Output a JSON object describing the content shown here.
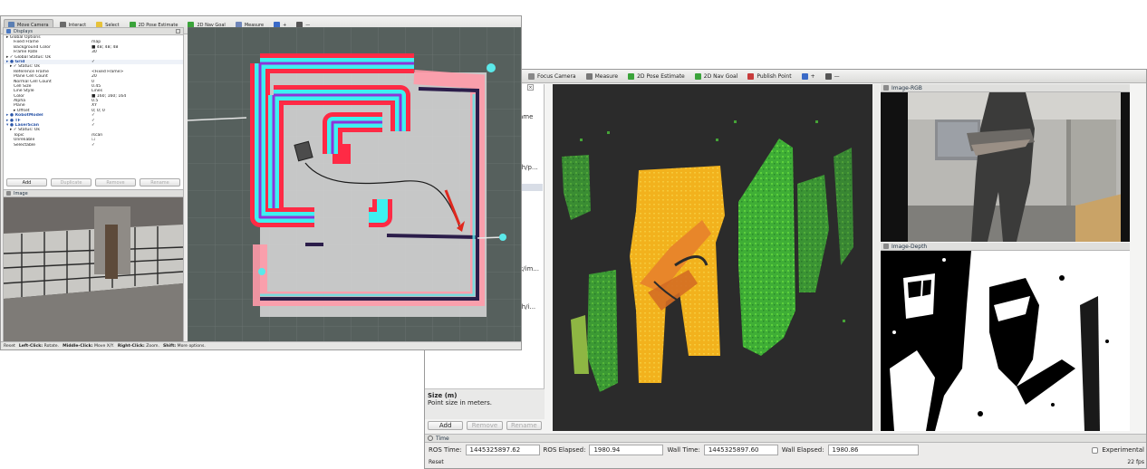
{
  "left_window": {
    "toolbar": [
      {
        "label": "Move Camera",
        "icon": "move-camera-icon",
        "color": "#5b7fb3",
        "active": true
      },
      {
        "label": "Interact",
        "icon": "interact-icon",
        "color": "#6a6a6a"
      },
      {
        "label": "Select",
        "icon": "select-icon",
        "color": "#e7c23a"
      },
      {
        "label": "2D Pose Estimate",
        "icon": "pose-arrow-icon",
        "color": "#3aa33a"
      },
      {
        "label": "2D Nav Goal",
        "icon": "nav-goal-icon",
        "color": "#3aa33a"
      },
      {
        "label": "Measure",
        "icon": "measure-icon",
        "color": "#6f86b9"
      },
      {
        "label": "+",
        "icon": "add-tool-icon",
        "color": "#3a6ac7"
      },
      {
        "label": "—",
        "icon": "remove-tool-icon",
        "color": "#555"
      }
    ],
    "displays_title": "Displays",
    "displays_rows": [
      {
        "k": "▸ Global Options",
        "v": "",
        "bold": false,
        "indent": 0
      },
      {
        "k": "Fixed Frame",
        "v": "map",
        "indent": 2
      },
      {
        "k": "Background Color",
        "v": "■ 48; 48; 48",
        "indent": 2
      },
      {
        "k": "Frame Rate",
        "v": "30",
        "indent": 2
      },
      {
        "k": "▸ ✓ Global Status: Ok",
        "v": "",
        "indent": 0
      },
      {
        "k": "▸ ● Grid",
        "v": "✓",
        "bold": true,
        "indent": 0
      },
      {
        "k": "▸ ✓ Status: Ok",
        "v": "",
        "indent": 1
      },
      {
        "k": "Reference Frame",
        "v": "<Fixed Frame>",
        "indent": 2
      },
      {
        "k": "Plane Cell Count",
        "v": "20",
        "indent": 2
      },
      {
        "k": "Normal Cell Count",
        "v": "0",
        "indent": 2
      },
      {
        "k": "Cell Size",
        "v": "0.45",
        "indent": 2
      },
      {
        "k": "Line Style",
        "v": "Lines",
        "indent": 2
      },
      {
        "k": "Color",
        "v": "■ 160; 160; 164",
        "indent": 2
      },
      {
        "k": "Alpha",
        "v": "0.5",
        "indent": 2
      },
      {
        "k": "Plane",
        "v": "XY",
        "indent": 2
      },
      {
        "k": "▸ Offset",
        "v": "0; 0; 0",
        "indent": 2
      },
      {
        "k": "▸ ● RobotModel",
        "v": "✓",
        "bold": true,
        "indent": 0
      },
      {
        "k": "▸ ● TF",
        "v": "✓",
        "bold": true,
        "indent": 0
      },
      {
        "k": "▾ ● LaserScan",
        "v": "✓",
        "bold": true,
        "indent": 0
      },
      {
        "k": "▸ ✓ Status: Ok",
        "v": "",
        "indent": 1
      },
      {
        "k": "Topic",
        "v": "/scan",
        "indent": 2
      },
      {
        "k": "Unreliable",
        "v": "☐",
        "indent": 2
      },
      {
        "k": "Selectable",
        "v": "✓",
        "indent": 2
      }
    ],
    "buttons": [
      "Add",
      "Duplicate",
      "Remove",
      "Rename"
    ],
    "image_title": "Image",
    "status": {
      "reset": "Reset",
      "t1": "Left-Click:",
      "d1": "Rotate.",
      "t2": "Middle-Click:",
      "d2": "Move X/Y.",
      "t3": "Right-Click:",
      "d3": "Zoom.",
      "t4": "Shift:",
      "d4": "More options."
    }
  },
  "right_window": {
    "toolbar": [
      {
        "label": "Focus Camera",
        "icon": "focus-camera-icon",
        "color": "#888"
      },
      {
        "label": "Measure",
        "icon": "measure-icon",
        "color": "#777"
      },
      {
        "label": "2D Pose Estimate",
        "icon": "pose-arrow-icon",
        "color": "#3aa33a"
      },
      {
        "label": "2D Nav Goal",
        "icon": "nav-goal-icon",
        "color": "#3aa33a"
      },
      {
        "label": "Publish Point",
        "icon": "publish-point-icon",
        "color": "#c83c3c"
      },
      {
        "label": "+",
        "icon": "add-tool-icon",
        "color": "#3a6ac7"
      },
      {
        "label": "—",
        "icon": "remove-tool-icon",
        "color": "#555"
      }
    ],
    "side_fragments": [
      "ame",
      "th/p...",
      "x/im...",
      "th/i..."
    ],
    "size_title": "Size (m)",
    "size_desc": "Point size in meters.",
    "buttons": [
      "Add",
      "Remove",
      "Rename"
    ],
    "image_rgb_title": "Image-RGB",
    "image_depth_title": "Image-Depth",
    "time_title": "Time",
    "time": {
      "ros_time_label": "ROS Time:",
      "ros_time": "1445325897.62",
      "ros_elapsed_label": "ROS Elapsed:",
      "ros_elapsed": "1980.94",
      "wall_time_label": "Wall Time:",
      "wall_time": "1445325897.60",
      "wall_elapsed_label": "Wall Elapsed:",
      "wall_elapsed": "1980.86",
      "experimental": "Experimental"
    },
    "reset": "Reset",
    "fps": "22 fps"
  }
}
